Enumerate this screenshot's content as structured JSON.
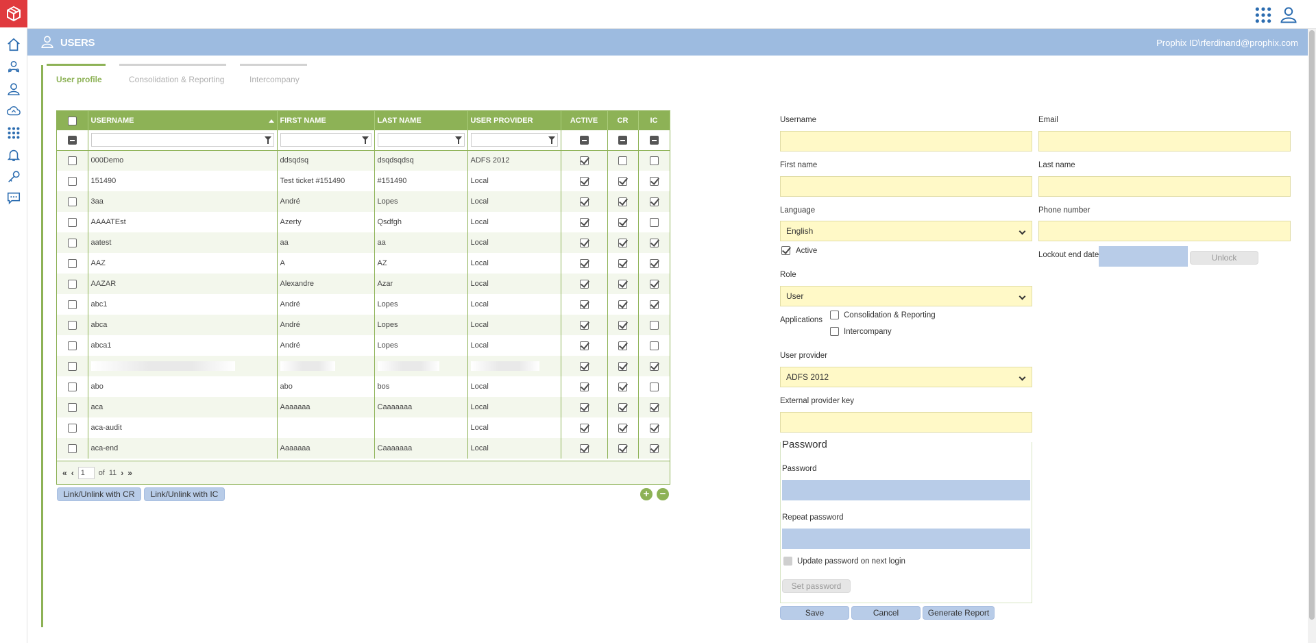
{
  "header": {
    "page_title": "USERS",
    "user_id": "Prophix ID\\rferdinand@prophix.com"
  },
  "tabs": [
    {
      "label": "User profile",
      "active": true
    },
    {
      "label": "Consolidation & Reporting",
      "active": false
    },
    {
      "label": "Intercompany",
      "active": false
    }
  ],
  "grid": {
    "columns": [
      "USERNAME",
      "FIRST NAME",
      "LAST NAME",
      "USER PROVIDER",
      "ACTIVE",
      "CR",
      "IC"
    ],
    "rows": [
      {
        "username": "000Demo",
        "first": "ddsqdsq",
        "last": "dsqdsqdsq",
        "provider": "ADFS 2012",
        "active": true,
        "cr": false,
        "ic": false
      },
      {
        "username": "151490",
        "first": "Test ticket #151490",
        "last": "#151490",
        "provider": "Local",
        "active": true,
        "cr": true,
        "ic": true
      },
      {
        "username": "3aa",
        "first": "André",
        "last": "Lopes",
        "provider": "Local",
        "active": true,
        "cr": true,
        "ic": true
      },
      {
        "username": "AAAATEst",
        "first": "Azerty",
        "last": "Qsdfgh",
        "provider": "Local",
        "active": true,
        "cr": true,
        "ic": false
      },
      {
        "username": "aatest",
        "first": "aa",
        "last": "aa",
        "provider": "Local",
        "active": true,
        "cr": true,
        "ic": true
      },
      {
        "username": "AAZ",
        "first": "A",
        "last": "AZ",
        "provider": "Local",
        "active": true,
        "cr": true,
        "ic": true
      },
      {
        "username": "AAZAR",
        "first": "Alexandre",
        "last": "Azar",
        "provider": "Local",
        "active": true,
        "cr": true,
        "ic": true
      },
      {
        "username": "abc1",
        "first": "André",
        "last": "Lopes",
        "provider": "Local",
        "active": true,
        "cr": true,
        "ic": true
      },
      {
        "username": "abca",
        "first": "André",
        "last": "Lopes",
        "provider": "Local",
        "active": true,
        "cr": true,
        "ic": false
      },
      {
        "username": "abca1",
        "first": "André",
        "last": "Lopes",
        "provider": "Local",
        "active": true,
        "cr": true,
        "ic": false
      },
      {
        "username": "",
        "first": "",
        "last": "",
        "provider": "",
        "active": true,
        "cr": true,
        "ic": true,
        "blurred": true
      },
      {
        "username": "abo",
        "first": "abo",
        "last": "bos",
        "provider": "Local",
        "active": true,
        "cr": true,
        "ic": false
      },
      {
        "username": "aca",
        "first": "Aaaaaaa",
        "last": "Caaaaaaa",
        "provider": "Local",
        "active": true,
        "cr": true,
        "ic": true
      },
      {
        "username": "aca-audit",
        "first": "",
        "last": "",
        "provider": "Local",
        "active": true,
        "cr": true,
        "ic": true
      },
      {
        "username": "aca-end",
        "first": "Aaaaaaa",
        "last": "Caaaaaaa",
        "provider": "Local",
        "active": true,
        "cr": true,
        "ic": true
      }
    ],
    "pager": {
      "page": "1",
      "of_label": "of",
      "total": "11"
    }
  },
  "grid_actions": {
    "link_cr": "Link/Unlink with CR",
    "link_ic": "Link/Unlink with IC",
    "add": "+",
    "remove": "−"
  },
  "form": {
    "username_label": "Username",
    "email_label": "Email",
    "first_name_label": "First name",
    "last_name_label": "Last name",
    "language_label": "Language",
    "language_value": "English",
    "phone_label": "Phone number",
    "active_label": "Active",
    "lockout_label": "Lockout end date",
    "unlock_label": "Unlock",
    "role_label": "Role",
    "role_value": "User",
    "applications_label": "Applications",
    "app_cr_label": "Consolidation & Reporting",
    "app_ic_label": "Intercompany",
    "provider_label": "User provider",
    "provider_value": "ADFS 2012",
    "ext_key_label": "External provider key",
    "password_section": "Password",
    "password_label": "Password",
    "repeat_label": "Repeat password",
    "update_pw_label": "Update password on next login",
    "set_pw_label": "Set password",
    "save_label": "Save",
    "cancel_label": "Cancel",
    "report_label": "Generate Report"
  }
}
